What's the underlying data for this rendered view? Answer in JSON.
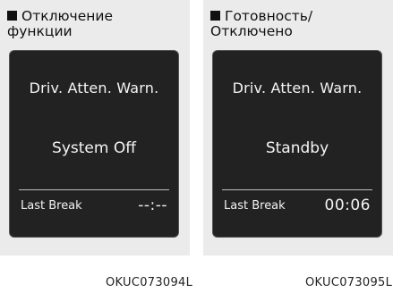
{
  "panels": [
    {
      "caption_line1": "Отключение",
      "caption_line2": "функции",
      "screen_title": "Driv. Atten. Warn.",
      "status": "System Off",
      "last_break_label": "Last Break",
      "last_break_value": "--:--",
      "code": "OKUC073094L"
    },
    {
      "caption_line1": "Готовность/",
      "caption_line2": "Отключено",
      "screen_title": "Driv. Atten. Warn.",
      "status": "Standby",
      "last_break_label": "Last Break",
      "last_break_value": "00:06",
      "code": "OKUC073095L"
    }
  ],
  "colors": {
    "panel_background": "#ebebeb",
    "screen_background": "#222222",
    "screen_text": "#f4f4f4"
  }
}
